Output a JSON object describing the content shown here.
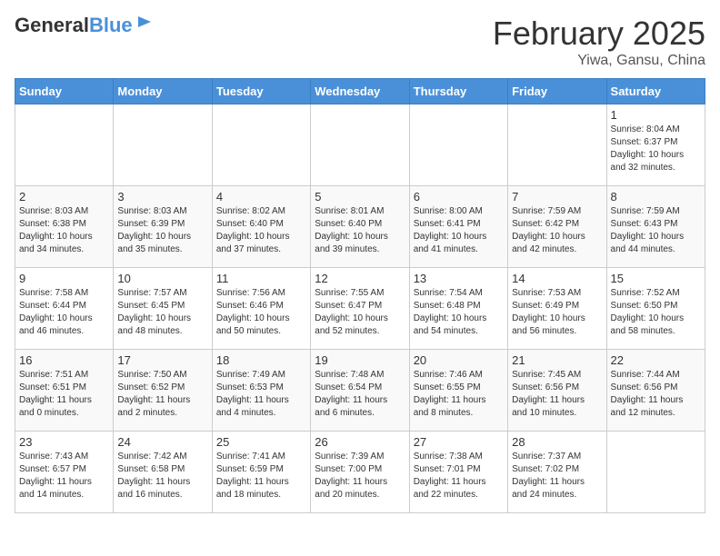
{
  "header": {
    "logo_line1": "General",
    "logo_line2": "Blue",
    "title": "February 2025",
    "subtitle": "Yiwa, Gansu, China"
  },
  "weekdays": [
    "Sunday",
    "Monday",
    "Tuesday",
    "Wednesday",
    "Thursday",
    "Friday",
    "Saturday"
  ],
  "weeks": [
    [
      {
        "day": "",
        "info": ""
      },
      {
        "day": "",
        "info": ""
      },
      {
        "day": "",
        "info": ""
      },
      {
        "day": "",
        "info": ""
      },
      {
        "day": "",
        "info": ""
      },
      {
        "day": "",
        "info": ""
      },
      {
        "day": "1",
        "info": "Sunrise: 8:04 AM\nSunset: 6:37 PM\nDaylight: 10 hours\nand 32 minutes."
      }
    ],
    [
      {
        "day": "2",
        "info": "Sunrise: 8:03 AM\nSunset: 6:38 PM\nDaylight: 10 hours\nand 34 minutes."
      },
      {
        "day": "3",
        "info": "Sunrise: 8:03 AM\nSunset: 6:39 PM\nDaylight: 10 hours\nand 35 minutes."
      },
      {
        "day": "4",
        "info": "Sunrise: 8:02 AM\nSunset: 6:40 PM\nDaylight: 10 hours\nand 37 minutes."
      },
      {
        "day": "5",
        "info": "Sunrise: 8:01 AM\nSunset: 6:40 PM\nDaylight: 10 hours\nand 39 minutes."
      },
      {
        "day": "6",
        "info": "Sunrise: 8:00 AM\nSunset: 6:41 PM\nDaylight: 10 hours\nand 41 minutes."
      },
      {
        "day": "7",
        "info": "Sunrise: 7:59 AM\nSunset: 6:42 PM\nDaylight: 10 hours\nand 42 minutes."
      },
      {
        "day": "8",
        "info": "Sunrise: 7:59 AM\nSunset: 6:43 PM\nDaylight: 10 hours\nand 44 minutes."
      }
    ],
    [
      {
        "day": "9",
        "info": "Sunrise: 7:58 AM\nSunset: 6:44 PM\nDaylight: 10 hours\nand 46 minutes."
      },
      {
        "day": "10",
        "info": "Sunrise: 7:57 AM\nSunset: 6:45 PM\nDaylight: 10 hours\nand 48 minutes."
      },
      {
        "day": "11",
        "info": "Sunrise: 7:56 AM\nSunset: 6:46 PM\nDaylight: 10 hours\nand 50 minutes."
      },
      {
        "day": "12",
        "info": "Sunrise: 7:55 AM\nSunset: 6:47 PM\nDaylight: 10 hours\nand 52 minutes."
      },
      {
        "day": "13",
        "info": "Sunrise: 7:54 AM\nSunset: 6:48 PM\nDaylight: 10 hours\nand 54 minutes."
      },
      {
        "day": "14",
        "info": "Sunrise: 7:53 AM\nSunset: 6:49 PM\nDaylight: 10 hours\nand 56 minutes."
      },
      {
        "day": "15",
        "info": "Sunrise: 7:52 AM\nSunset: 6:50 PM\nDaylight: 10 hours\nand 58 minutes."
      }
    ],
    [
      {
        "day": "16",
        "info": "Sunrise: 7:51 AM\nSunset: 6:51 PM\nDaylight: 11 hours\nand 0 minutes."
      },
      {
        "day": "17",
        "info": "Sunrise: 7:50 AM\nSunset: 6:52 PM\nDaylight: 11 hours\nand 2 minutes."
      },
      {
        "day": "18",
        "info": "Sunrise: 7:49 AM\nSunset: 6:53 PM\nDaylight: 11 hours\nand 4 minutes."
      },
      {
        "day": "19",
        "info": "Sunrise: 7:48 AM\nSunset: 6:54 PM\nDaylight: 11 hours\nand 6 minutes."
      },
      {
        "day": "20",
        "info": "Sunrise: 7:46 AM\nSunset: 6:55 PM\nDaylight: 11 hours\nand 8 minutes."
      },
      {
        "day": "21",
        "info": "Sunrise: 7:45 AM\nSunset: 6:56 PM\nDaylight: 11 hours\nand 10 minutes."
      },
      {
        "day": "22",
        "info": "Sunrise: 7:44 AM\nSunset: 6:56 PM\nDaylight: 11 hours\nand 12 minutes."
      }
    ],
    [
      {
        "day": "23",
        "info": "Sunrise: 7:43 AM\nSunset: 6:57 PM\nDaylight: 11 hours\nand 14 minutes."
      },
      {
        "day": "24",
        "info": "Sunrise: 7:42 AM\nSunset: 6:58 PM\nDaylight: 11 hours\nand 16 minutes."
      },
      {
        "day": "25",
        "info": "Sunrise: 7:41 AM\nSunset: 6:59 PM\nDaylight: 11 hours\nand 18 minutes."
      },
      {
        "day": "26",
        "info": "Sunrise: 7:39 AM\nSunset: 7:00 PM\nDaylight: 11 hours\nand 20 minutes."
      },
      {
        "day": "27",
        "info": "Sunrise: 7:38 AM\nSunset: 7:01 PM\nDaylight: 11 hours\nand 22 minutes."
      },
      {
        "day": "28",
        "info": "Sunrise: 7:37 AM\nSunset: 7:02 PM\nDaylight: 11 hours\nand 24 minutes."
      },
      {
        "day": "",
        "info": ""
      }
    ]
  ]
}
